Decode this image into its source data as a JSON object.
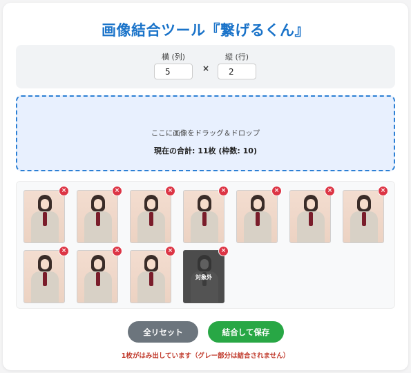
{
  "title": "画像結合ツール『繋げるくん』",
  "settings": {
    "cols_label": "横 (列)",
    "cols_value": "5",
    "times": "×",
    "rows_label": "縦 (行)",
    "rows_value": "2"
  },
  "dropzone": {
    "instruction": "ここに画像をドラッグ＆ドロップ",
    "count": "現在の合計: 11枚 (枠数: 10)"
  },
  "thumbnails": {
    "delete_glyph": "×",
    "excluded_label": "対象外",
    "items": [
      {
        "state": "included"
      },
      {
        "state": "included"
      },
      {
        "state": "included"
      },
      {
        "state": "included"
      },
      {
        "state": "included"
      },
      {
        "state": "included"
      },
      {
        "state": "included"
      },
      {
        "state": "included"
      },
      {
        "state": "included"
      },
      {
        "state": "included"
      },
      {
        "state": "excluded"
      }
    ]
  },
  "buttons": {
    "reset": "全リセット",
    "save": "結合して保存"
  },
  "warning": "1枚がはみ出しています（グレー部分は結合されません）",
  "colors": {
    "accent": "#1a73c9",
    "dropzone_border": "#2b7fd4",
    "delete": "#dc3545",
    "reset": "#6c757d",
    "save": "#28a745",
    "warning": "#c0392b"
  }
}
